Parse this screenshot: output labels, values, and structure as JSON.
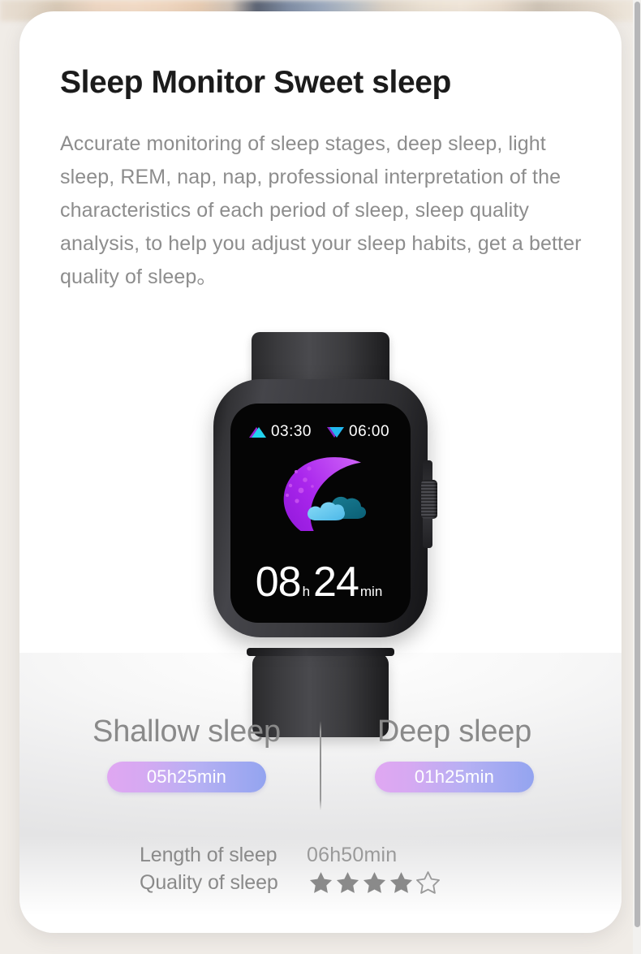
{
  "card": {
    "title": "Sleep Monitor Sweet sleep",
    "description": "Accurate monitoring of sleep stages, deep sleep, light sleep, REM, nap, nap, professional interpretation of the characteristics of each period of sleep, sleep quality analysis, to help you adjust your sleep habits, get a better quality of sleep。"
  },
  "watch": {
    "screen": {
      "sleep_start_label": "03:30",
      "sleep_end_label": "06:00",
      "start_icon": "triangle-up-icon",
      "end_icon": "triangle-down-icon",
      "illustration_icon": "crescent-moon-cloud-icon",
      "duration_hours": "08",
      "duration_hours_unit": "h",
      "duration_minutes": "24",
      "duration_minutes_unit": "min"
    },
    "crown_icon": "watch-crown-icon"
  },
  "stats": {
    "shallow": {
      "title": "Shallow sleep",
      "value": "05h25min"
    },
    "deep": {
      "title": "Deep sleep",
      "value": "01h25min"
    }
  },
  "summary": {
    "length_label": "Length of sleep",
    "length_value": "06h50min",
    "quality_label": "Quality of sleep",
    "quality_rating": 4,
    "quality_max": 5
  },
  "colors": {
    "accent_pill_start": "#e0a7f2",
    "accent_pill_end": "#93a4f0",
    "moon_purple": "#a020e8",
    "moon_purple_light": "#c64cf5",
    "cloud_cyan": "#5ec8f0",
    "cloud_teal": "#0e6f85",
    "triangle_cyan": "#22d3ee",
    "triangle_purple": "#a828e6",
    "title_text": "#1b1b1b",
    "body_text": "#8d8d8d",
    "stat_text": "#8a8a8a",
    "star_filled": "#8a8a8a",
    "star_empty": "#9a9a9a"
  }
}
